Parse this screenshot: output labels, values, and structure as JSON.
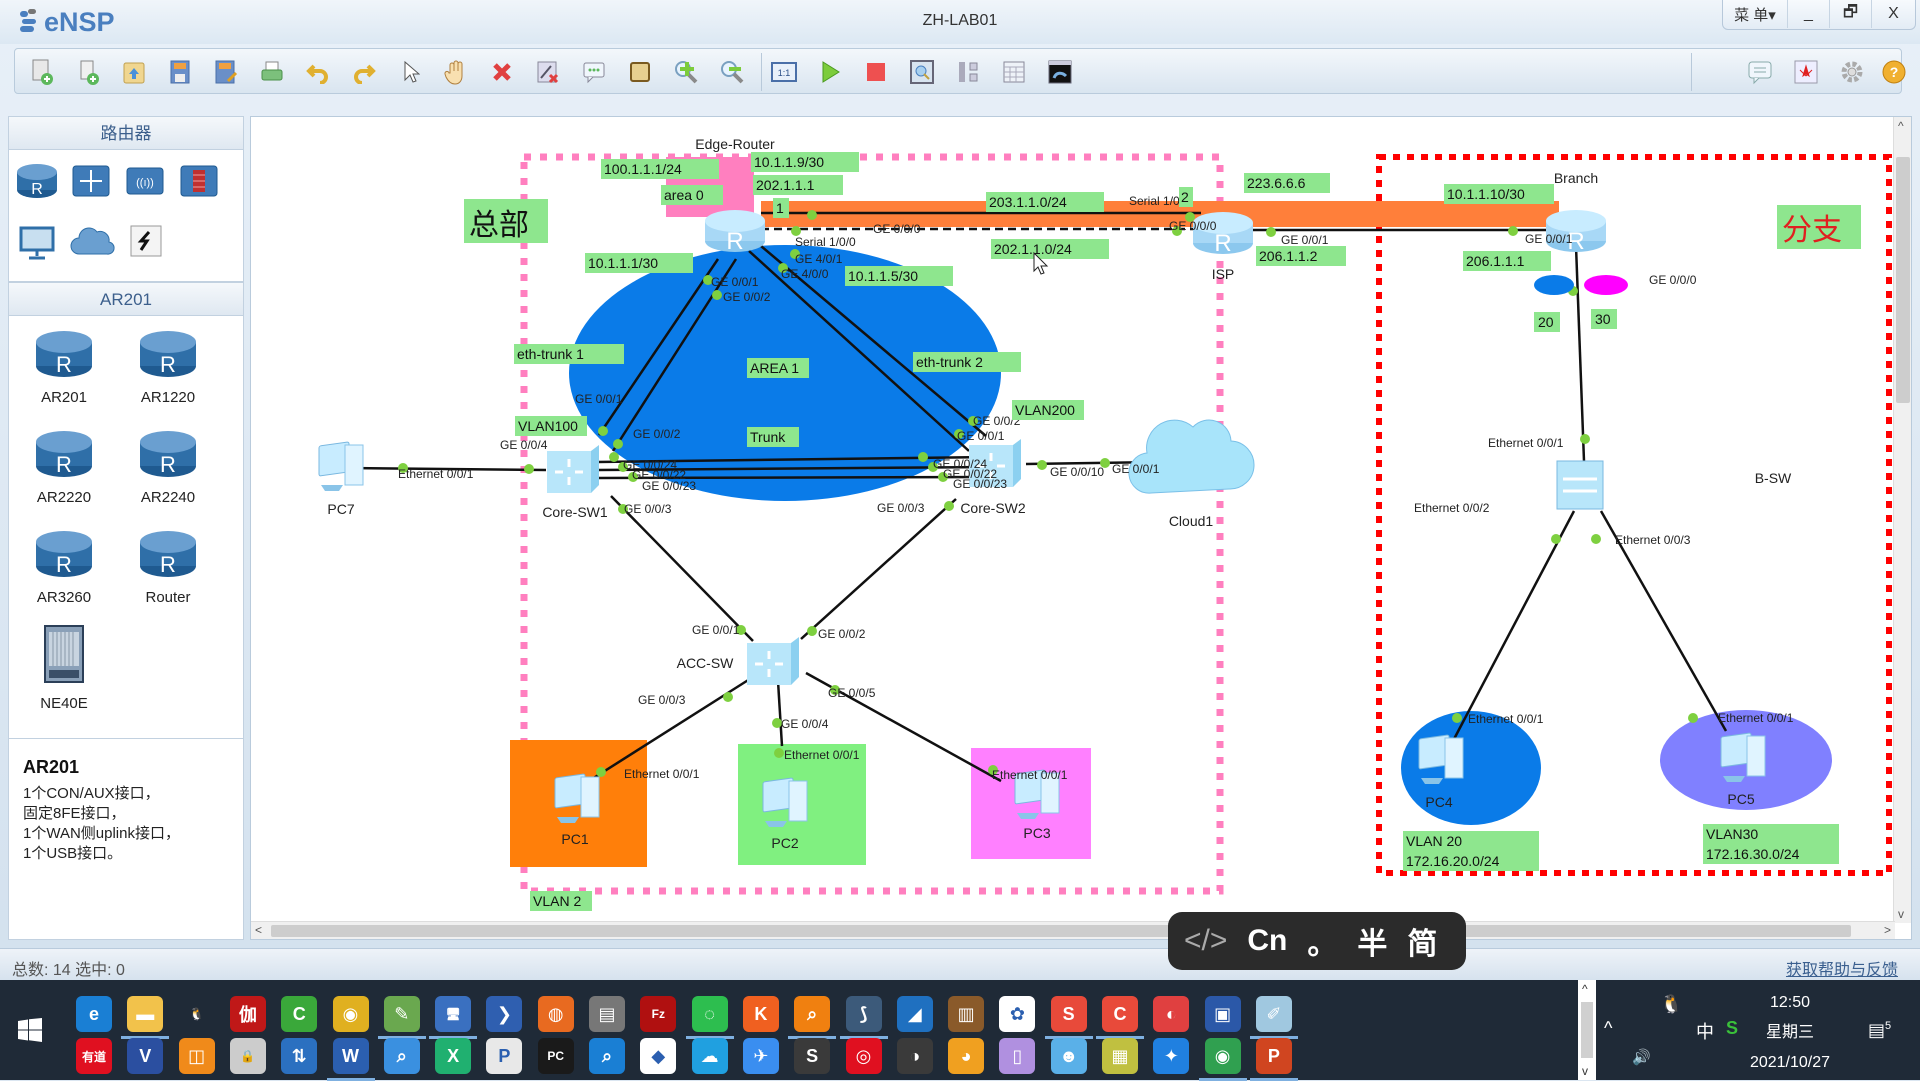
{
  "app": {
    "logo": "eNSP",
    "title": "ZH-LAB01",
    "menu_label": "菜 单▾",
    "minimize": "_",
    "restore": "🗗",
    "close": "X"
  },
  "toolbar": {
    "buttons": [
      {
        "name": "new-topology",
        "icon": "new-file-icon"
      },
      {
        "name": "new-exam",
        "icon": "new-scroll-icon"
      },
      {
        "name": "open",
        "icon": "open-folder-icon"
      },
      {
        "name": "save",
        "icon": "save-icon"
      },
      {
        "name": "save-as",
        "icon": "save-as-icon"
      },
      {
        "name": "print",
        "icon": "print-icon"
      },
      {
        "name": "undo",
        "icon": "undo-icon"
      },
      {
        "name": "redo",
        "icon": "redo-icon"
      },
      {
        "name": "select",
        "icon": "pointer-icon"
      },
      {
        "name": "pan",
        "icon": "hand-icon"
      },
      {
        "name": "delete",
        "icon": "delete-icon"
      },
      {
        "name": "delete-link",
        "icon": "delete-link-icon"
      },
      {
        "name": "text-note",
        "icon": "note-icon"
      },
      {
        "name": "palette",
        "icon": "palette-icon"
      },
      {
        "name": "zoom-in",
        "icon": "zoom-in-icon"
      },
      {
        "name": "zoom-out",
        "icon": "zoom-out-icon"
      },
      {
        "name": "fit",
        "icon": "fit-1to1-icon"
      },
      {
        "name": "start",
        "icon": "play-icon"
      },
      {
        "name": "stop",
        "icon": "stop-icon"
      },
      {
        "name": "capture",
        "icon": "capture-icon"
      },
      {
        "name": "topology",
        "icon": "topology-icon"
      },
      {
        "name": "grid",
        "icon": "grid-icon"
      },
      {
        "name": "console",
        "icon": "console-icon"
      }
    ],
    "right_buttons": [
      {
        "name": "chat",
        "icon": "chat-icon"
      },
      {
        "name": "huawei",
        "icon": "huawei-logo-icon"
      },
      {
        "name": "settings",
        "icon": "gear-icon"
      },
      {
        "name": "help",
        "icon": "help-icon"
      }
    ]
  },
  "left_panel": {
    "category_header": "路由器",
    "categories": [
      "router",
      "switch",
      "wlan",
      "firewall",
      "terminal",
      "cloud",
      "connection"
    ],
    "model_header": "AR201",
    "models": [
      "AR201",
      "AR1220",
      "AR2220",
      "AR2240",
      "AR3260",
      "Router",
      "NE40E"
    ],
    "description": {
      "title": "AR201",
      "lines": [
        "1个CON/AUX接口，",
        "固定8FE接口，",
        "1个WAN侧uplink接口，",
        "1个USB接口。"
      ]
    }
  },
  "topology": {
    "zones": {
      "hq_label": "总部",
      "branch_label": "分支",
      "vlan2_label": "VLAN  2"
    },
    "devices": {
      "edge_router": "Edge-Router",
      "isp": "ISP",
      "branch": "Branch",
      "core_sw1": "Core-SW1",
      "core_sw2": "Core-SW2",
      "acc_sw": "ACC-SW",
      "b_sw": "B-SW",
      "cloud1": "Cloud1",
      "pc1": "PC1",
      "pc2": "PC2",
      "pc3": "PC3",
      "pc4": "PC4",
      "pc5": "PC5",
      "pc7": "PC7"
    },
    "notes": {
      "ip_100": "100.1.1.1/24",
      "area0": "area 0",
      "ip_10_9": "10.1.1.9/30",
      "ip_202_1": "202.1.1.1",
      "one": "1",
      "ip_10_1": "10.1.1.1/30",
      "ip_10_5": "10.1.1.5/30",
      "net_203": "203.1.1.0/24",
      "net_202": "202.1.1.0/24",
      "two": "2",
      "ip_223": "223.6.6.6",
      "ip_206_2": "206.1.1.2",
      "ip_10_10": "10.1.1.10/30",
      "ip_206_1": "206.1.1.1",
      "v20": "20",
      "v30": "30",
      "eth_trunk1": "eth-trunk 1",
      "eth_trunk2": "eth-trunk 2",
      "area1": "AREA 1",
      "trunk": "Trunk",
      "vlan100": "VLAN100",
      "vlan200": "VLAN200",
      "vlan20_l1": "VLAN 20",
      "vlan20_l2": "172.16.20.0/24",
      "vlan30_l1": "VLAN30",
      "vlan30_l2": "172.16.30.0/24"
    },
    "ports": {
      "er_s100": "Serial 1/0/0",
      "er_ge000": "GE 0/0/0",
      "er_ge401": "GE 4/0/1",
      "er_ge400": "GE 4/0/0",
      "er_ge001": "GE 0/0/1",
      "er_ge002": "GE 0/0/2",
      "isp_s100": "Serial 1/0/0",
      "isp_ge000": "GE 0/0/0",
      "isp_ge001": "GE 0/0/1",
      "br_ge001": "GE 0/0/1",
      "br_ge000": "GE 0/0/0",
      "c1_ge001": "GE 0/0/1",
      "c1_ge002": "GE 0/0/2",
      "c1_ge004": "GE 0/0/4",
      "c1_ge024": "GE 0/0/24",
      "c1_ge022": "GE 0/0/22",
      "c1_ge023": "GE 0/0/23",
      "c1_ge003": "GE 0/0/3",
      "pc7_eth": "Ethernet 0/0/1",
      "c2_ge002": "GE 0/0/2",
      "c2_ge001": "GE 0/0/1",
      "c2_ge024": "GE 0/0/24",
      "c2_ge022": "GE 0/0/22",
      "c2_ge023": "GE 0/0/23",
      "c2_ge003": "GE 0/0/3",
      "c2_ge010": "GE 0/0/10",
      "cloud_ge001": "GE 0/0/1",
      "acc_ge001": "GE 0/0/1",
      "acc_ge002": "GE 0/0/2",
      "acc_ge003": "GE 0/0/3",
      "acc_ge004": "GE 0/0/4",
      "acc_ge005": "GE 0/0/5",
      "pc1_eth": "Ethernet 0/0/1",
      "pc2_eth": "Ethernet 0/0/1",
      "pc3_eth": "Ethernet 0/0/1",
      "bsw_eth1": "Ethernet 0/0/1",
      "bsw_eth2": "Ethernet 0/0/2",
      "bsw_eth3": "Ethernet 0/0/3",
      "pc4_eth": "Ethernet 0/0/1",
      "pc5_eth": "Ethernet 0/0/1"
    },
    "colors": {
      "hq_border": "#ff7fbf",
      "branch_border": "#ff0000",
      "area1_fill": "#0a7be8",
      "wan_band": "#ff7f3a",
      "note_bg": "#8ee68e",
      "pc1_bg": "#ff7f0a",
      "pc2_bg": "#80f080",
      "pc3_bg": "#ff80ff",
      "pc4_ellipse": "#0a7be8",
      "pc5_ellipse": "#8080ff",
      "port_dot": "#7ed040",
      "vlan20_dot": "#0a7be8",
      "vlan30_dot": "#ff00ff"
    }
  },
  "status": {
    "text": "总数: 14  选中: 0",
    "help_link": "获取帮助与反馈"
  },
  "ime": {
    "code": "</>",
    "lang": "Cn",
    "punct": "。",
    "width": "半",
    "script": "简"
  },
  "taskbar": {
    "row1": [
      {
        "name": "edge",
        "glyph": "e",
        "bg": "#1a7fd4",
        "active": false
      },
      {
        "name": "file-explorer",
        "glyph": "▬",
        "bg": "#f2c24b",
        "active": true
      },
      {
        "name": "qq",
        "glyph": "🐧",
        "bg": "transparent",
        "active": false
      },
      {
        "name": "jia",
        "glyph": "伽",
        "bg": "#c01818",
        "active": false
      },
      {
        "name": "camtasia",
        "glyph": "C",
        "bg": "#3aa83a",
        "active": false
      },
      {
        "name": "chrome",
        "glyph": "◉",
        "bg": "#e0b020",
        "active": false
      },
      {
        "name": "notepad-plus",
        "glyph": "✎",
        "bg": "#6aa84f",
        "active": true
      },
      {
        "name": "remote-desktop",
        "glyph": "🖥",
        "bg": "#3a70c0",
        "active": true
      },
      {
        "name": "powershell",
        "glyph": "❯",
        "bg": "#2f5fb0",
        "active": false
      },
      {
        "name": "firefox",
        "glyph": "◍",
        "bg": "#e86a20",
        "active": false
      },
      {
        "name": "vm-lock",
        "glyph": "▤",
        "bg": "#777",
        "active": false
      },
      {
        "name": "filezilla",
        "glyph": "Fz",
        "bg": "#b01010",
        "active": false
      },
      {
        "name": "wechat",
        "glyph": "◌",
        "bg": "#2dbe4f",
        "active": true
      },
      {
        "name": "kingsoft",
        "glyph": "K",
        "bg": "#f06020",
        "active": false
      },
      {
        "name": "search-tool",
        "glyph": "⌕",
        "bg": "#f08010",
        "active": true
      },
      {
        "name": "ensp",
        "glyph": "⟆",
        "bg": "#3c5a7a",
        "active": true
      },
      {
        "name": "wireshark",
        "glyph": "◢",
        "bg": "#1f70c0",
        "active": false
      },
      {
        "name": "library",
        "glyph": "▥",
        "bg": "#8a5a2a",
        "active": false
      },
      {
        "name": "baidu-netdisk",
        "glyph": "✿",
        "bg": "#ffffff",
        "active": false
      },
      {
        "name": "wps-s",
        "glyph": "S",
        "bg": "#e84a3a",
        "active": true
      },
      {
        "name": "wps-c",
        "glyph": "C",
        "bg": "#e84a3a",
        "active": true
      },
      {
        "name": "snail",
        "glyph": "◐",
        "bg": "#e04040",
        "active": false
      },
      {
        "name": "floppy",
        "glyph": "▣",
        "bg": "#2b58a8",
        "active": false
      },
      {
        "name": "paint",
        "glyph": "✐",
        "bg": "#a0c8e0",
        "active": true
      }
    ],
    "row2": [
      {
        "name": "youdao",
        "glyph": "有道",
        "bg": "#e01020",
        "active": false
      },
      {
        "name": "visio",
        "glyph": "V",
        "bg": "#2b4fa0",
        "active": false
      },
      {
        "name": "vmware",
        "glyph": "◫",
        "bg": "#f08a1a",
        "active": false
      },
      {
        "name": "lock-app",
        "glyph": "🔒",
        "bg": "#cccccc",
        "active": false
      },
      {
        "name": "secure-transfer",
        "glyph": "⇅",
        "bg": "#2b70c0",
        "active": false
      },
      {
        "name": "word",
        "glyph": "W",
        "bg": "#2b5fb0",
        "active": true
      },
      {
        "name": "magnifier",
        "glyph": "⌕",
        "bg": "#3a90e0",
        "active": false
      },
      {
        "name": "xmind",
        "glyph": "X",
        "bg": "#20b070",
        "active": false
      },
      {
        "name": "python-file",
        "glyph": "P",
        "bg": "#e8e8e8",
        "active": false
      },
      {
        "name": "pycharm",
        "glyph": "PC",
        "bg": "#1a1a1a",
        "active": false
      },
      {
        "name": "doc-search",
        "glyph": "⌕",
        "bg": "#1a7fd4",
        "active": false
      },
      {
        "name": "tool-s",
        "glyph": "◆",
        "bg": "#ffffff",
        "active": false
      },
      {
        "name": "cloud-app",
        "glyph": "☁",
        "bg": "#20a0e0",
        "active": false
      },
      {
        "name": "feishu",
        "glyph": "✈",
        "bg": "#3a8ef0",
        "active": false
      },
      {
        "name": "sublime",
        "glyph": "S",
        "bg": "#3a3a3a",
        "active": false
      },
      {
        "name": "netease-music",
        "glyph": "◎",
        "bg": "#e01020",
        "active": false
      },
      {
        "name": "sync-tool",
        "glyph": "◑",
        "bg": "#3a3a3a",
        "active": false
      },
      {
        "name": "orange-app",
        "glyph": "◕",
        "bg": "#f0a020",
        "active": false
      },
      {
        "name": "purple-app",
        "glyph": "▯",
        "bg": "#b090e0",
        "active": false
      },
      {
        "name": "live-app",
        "glyph": "☻",
        "bg": "#5ab0e8",
        "active": false
      },
      {
        "name": "tcp-ip",
        "glyph": "▦",
        "bg": "#c0c040",
        "active": false
      },
      {
        "name": "blue-app",
        "glyph": "✦",
        "bg": "#2080e0",
        "active": false
      },
      {
        "name": "chrome-profile",
        "glyph": "◉",
        "bg": "#30a050",
        "active": true
      },
      {
        "name": "powerpoint",
        "glyph": "P",
        "bg": "#d04520",
        "active": true
      }
    ],
    "tray": {
      "up_arrow": "^",
      "ime_indicator": "中",
      "volume": "🔊",
      "time": "12:50",
      "weekday": "星期三",
      "date": "2021/10/27",
      "notifications": "5"
    }
  }
}
